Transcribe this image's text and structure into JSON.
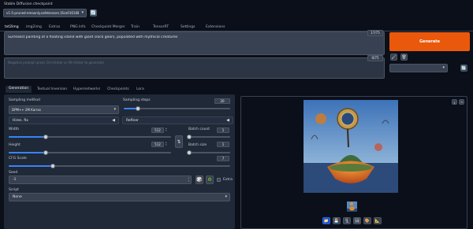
{
  "checkpoint": {
    "label": "Stable Diffusion checkpoint",
    "value": "v1-5-pruned-emaonly.safetensors [6ce0161689]"
  },
  "main_tabs": [
    "txt2img",
    "img2img",
    "Extras",
    "PNG Info",
    "Checkpoint Merger",
    "Train",
    "TensorRT",
    "Settings",
    "Extensions"
  ],
  "prompt": {
    "value": "Surrealist painting of a floating island with giant clock gears, populated with mythical creatures",
    "token_count": "17/75"
  },
  "negative_prompt": {
    "placeholder": "Negative prompt (press Ctrl+Enter or Alt+Enter to generate)",
    "token_count": "0/75"
  },
  "generate_label": "Generate",
  "sub_tabs": [
    "Generation",
    "Textual Inversion",
    "Hypernetworks",
    "Checkpoints",
    "Lora"
  ],
  "sampling": {
    "method_label": "Sampling method",
    "method_value": "DPM++ 2M Karras",
    "steps_label": "Sampling steps",
    "steps_value": "20",
    "steps_fraction": 0.13
  },
  "accordions": {
    "hires": "Hires. fix",
    "refiner": "Refiner"
  },
  "width": {
    "label": "Width",
    "value": "512",
    "fraction": 0.23
  },
  "height": {
    "label": "Height",
    "value": "512",
    "fraction": 0.23
  },
  "batch_count": {
    "label": "Batch count",
    "value": "1",
    "fraction": 0.0
  },
  "batch_size": {
    "label": "Batch size",
    "value": "1",
    "fraction": 0.0
  },
  "cfg": {
    "label": "CFG Scale",
    "value": "7",
    "fraction": 0.2
  },
  "seed": {
    "label": "Seed",
    "value": "-1",
    "extra_label": "Extra"
  },
  "script": {
    "label": "Script",
    "value": "None"
  },
  "colors": {
    "accent_orange": "#ea580c",
    "slider_blue": "#3b82f6",
    "bg": "#0b0f19",
    "panel": "#1f2937"
  },
  "icons": {
    "refresh": "refresh-icon",
    "swap": "swap-icon",
    "dice": "dice-icon",
    "recycle": "recycle-icon",
    "styles": [
      "paint-icon",
      "trash-icon"
    ],
    "output_toolbar": [
      "folder-icon",
      "save-icon",
      "zip-icon",
      "image-icon",
      "palette-icon",
      "extras-icon"
    ]
  }
}
